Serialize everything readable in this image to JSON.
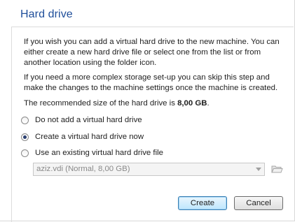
{
  "title": "Hard drive",
  "intro": "If you wish you can add a virtual hard drive to the new machine. You can either create a new hard drive file or select one from the list or from another location using the folder icon.",
  "complex_setup": "If you need a more complex storage set-up you can skip this step and make the changes to the machine settings once the machine is created.",
  "recommended_prefix": "The recommended size of the hard drive is ",
  "recommended_size": "8,00 GB",
  "recommended_suffix": ".",
  "options": [
    {
      "label": "Do not add a virtual hard drive",
      "selected": false
    },
    {
      "label": "Create a virtual hard drive now",
      "selected": true
    },
    {
      "label": "Use an existing virtual hard drive file",
      "selected": false
    }
  ],
  "existing_file": {
    "value": "aziz.vdi (Normal, 8,00 GB)",
    "enabled": false
  },
  "buttons": {
    "create": "Create",
    "cancel": "Cancel"
  },
  "icons": {
    "folder": "folder-open-icon",
    "dropdown": "chevron-down-icon"
  }
}
